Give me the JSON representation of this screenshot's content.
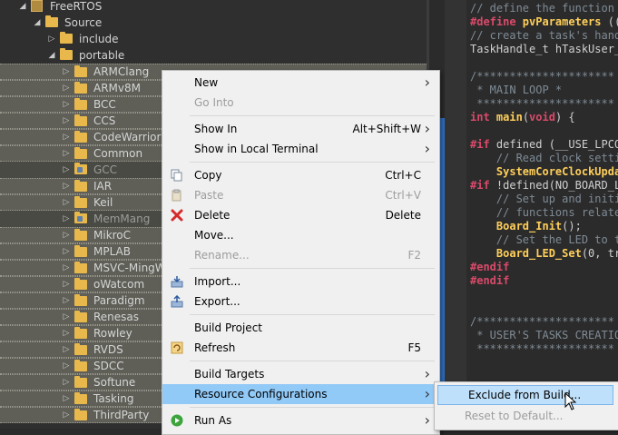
{
  "tree": {
    "rows": [
      {
        "label": "FreeRTOS",
        "indent": 1,
        "type": "project",
        "arrow": "open"
      },
      {
        "label": "Source",
        "indent": 2,
        "type": "folder",
        "arrow": "open"
      },
      {
        "label": "include",
        "indent": 3,
        "type": "folder",
        "arrow": "closed"
      },
      {
        "label": "portable",
        "indent": 3,
        "type": "folder",
        "arrow": "open"
      },
      {
        "label": "ARMClang",
        "indent": 4,
        "type": "folder",
        "arrow": "closed",
        "sel": true
      },
      {
        "label": "ARMv8M",
        "indent": 4,
        "type": "folder",
        "arrow": "closed",
        "sel": true
      },
      {
        "label": "BCC",
        "indent": 4,
        "type": "folder",
        "arrow": "closed",
        "sel": true
      },
      {
        "label": "CCS",
        "indent": 4,
        "type": "folder",
        "arrow": "closed",
        "sel": true
      },
      {
        "label": "CodeWarrior",
        "indent": 4,
        "type": "folder",
        "arrow": "closed",
        "sel": true
      },
      {
        "label": "Common",
        "indent": 4,
        "type": "folder",
        "arrow": "closed",
        "sel": true
      },
      {
        "label": "GCC",
        "indent": 4,
        "type": "folder",
        "arrow": "closed",
        "dim": true,
        "exc": true
      },
      {
        "label": "IAR",
        "indent": 4,
        "type": "folder",
        "arrow": "closed",
        "sel": true
      },
      {
        "label": "Keil",
        "indent": 4,
        "type": "folder",
        "arrow": "closed",
        "sel": true
      },
      {
        "label": "MemMang",
        "indent": 4,
        "type": "folder",
        "arrow": "closed",
        "dim": true,
        "exc": true
      },
      {
        "label": "MikroC",
        "indent": 4,
        "type": "folder",
        "arrow": "closed",
        "sel": true
      },
      {
        "label": "MPLAB",
        "indent": 4,
        "type": "folder",
        "arrow": "closed",
        "sel": true
      },
      {
        "label": "MSVC-MingW",
        "indent": 4,
        "type": "folder",
        "arrow": "closed",
        "sel": true
      },
      {
        "label": "oWatcom",
        "indent": 4,
        "type": "folder",
        "arrow": "closed",
        "sel": true
      },
      {
        "label": "Paradigm",
        "indent": 4,
        "type": "folder",
        "arrow": "closed",
        "sel": true
      },
      {
        "label": "Renesas",
        "indent": 4,
        "type": "folder",
        "arrow": "closed",
        "sel": true
      },
      {
        "label": "Rowley",
        "indent": 4,
        "type": "folder",
        "arrow": "closed",
        "sel": true
      },
      {
        "label": "RVDS",
        "indent": 4,
        "type": "folder",
        "arrow": "closed",
        "sel": true
      },
      {
        "label": "SDCC",
        "indent": 4,
        "type": "folder",
        "arrow": "closed",
        "sel": true
      },
      {
        "label": "Softune",
        "indent": 4,
        "type": "folder",
        "arrow": "closed",
        "sel": true
      },
      {
        "label": "Tasking",
        "indent": 4,
        "type": "folder",
        "arrow": "closed",
        "sel": true
      },
      {
        "label": "ThirdParty",
        "indent": 4,
        "type": "folder",
        "arrow": "closed",
        "sel": true
      }
    ]
  },
  "editor": {
    "lines": [
      [
        {
          "t": "// define the function ",
          "c": "cmt"
        }
      ],
      [
        {
          "t": "#define ",
          "c": "kw"
        },
        {
          "t": "pvParameters",
          "c": "fn"
        },
        {
          "t": " ((",
          "c": "str"
        }
      ],
      [
        {
          "t": "// create a task's hand",
          "c": "cmt"
        }
      ],
      [
        {
          "t": "TaskHandle_t hTaskUser_",
          "c": "str"
        }
      ],
      [
        {
          "t": "",
          "c": "str"
        }
      ],
      [
        {
          "t": "/*********************",
          "c": "cmt"
        }
      ],
      [
        {
          "t": " * MAIN LOOP *",
          "c": "cmt"
        }
      ],
      [
        {
          "t": " *********************",
          "c": "cmt"
        }
      ],
      [
        {
          "t": "int ",
          "c": "kw"
        },
        {
          "t": "main",
          "c": "fn"
        },
        {
          "t": "(",
          "c": "str"
        },
        {
          "t": "void",
          "c": "kw"
        },
        {
          "t": ") {",
          "c": "str"
        }
      ],
      [
        {
          "t": "",
          "c": "str"
        }
      ],
      [
        {
          "t": "#if ",
          "c": "kw"
        },
        {
          "t": "defined (__USE_LPCO",
          "c": "str"
        }
      ],
      [
        {
          "t": "    // Read clock setti",
          "c": "cmt"
        }
      ],
      [
        {
          "t": "    ",
          "c": "str"
        },
        {
          "t": "SystemCoreClockUpda",
          "c": "fn"
        }
      ],
      [
        {
          "t": "#if ",
          "c": "kw"
        },
        {
          "t": "!defined(NO_BOARD_L",
          "c": "str"
        }
      ],
      [
        {
          "t": "    // Set up and initi",
          "c": "cmt"
        }
      ],
      [
        {
          "t": "    // functions relate",
          "c": "cmt"
        }
      ],
      [
        {
          "t": "    ",
          "c": "str"
        },
        {
          "t": "Board_Init",
          "c": "fn"
        },
        {
          "t": "();",
          "c": "str"
        }
      ],
      [
        {
          "t": "    // Set the LED to t",
          "c": "cmt"
        }
      ],
      [
        {
          "t": "    ",
          "c": "str"
        },
        {
          "t": "Board_LED_Set",
          "c": "fn"
        },
        {
          "t": "(0, tr",
          "c": "str"
        }
      ],
      [
        {
          "t": "#endif",
          "c": "kw"
        }
      ],
      [
        {
          "t": "#endif",
          "c": "kw"
        }
      ],
      [
        {
          "t": "",
          "c": "str"
        }
      ],
      [
        {
          "t": "",
          "c": "str"
        }
      ],
      [
        {
          "t": "/*********************",
          "c": "cmt"
        }
      ],
      [
        {
          "t": " * USER'S TASKS CREATION",
          "c": "cmt"
        }
      ],
      [
        {
          "t": " *********************",
          "c": "cmt"
        }
      ]
    ]
  },
  "menu": {
    "items": [
      {
        "label": "New",
        "shortcut": "",
        "submenu": true
      },
      {
        "label": "Go Into",
        "disabled": true
      },
      {
        "sep": true
      },
      {
        "label": "Show In",
        "shortcut": "Alt+Shift+W",
        "submenu": true
      },
      {
        "label": "Show in Local Terminal",
        "submenu": true
      },
      {
        "sep": true
      },
      {
        "label": "Copy",
        "shortcut": "Ctrl+C",
        "icon": "copy-icon"
      },
      {
        "label": "Paste",
        "shortcut": "Ctrl+V",
        "icon": "paste-icon",
        "disabled": true
      },
      {
        "label": "Delete",
        "shortcut": "Delete",
        "icon": "delete-icon"
      },
      {
        "label": "Move..."
      },
      {
        "label": "Rename...",
        "shortcut": "F2",
        "disabled": true
      },
      {
        "sep": true
      },
      {
        "label": "Import...",
        "icon": "import-icon"
      },
      {
        "label": "Export...",
        "icon": "export-icon"
      },
      {
        "sep": true
      },
      {
        "label": "Build Project"
      },
      {
        "label": "Refresh",
        "shortcut": "F5",
        "icon": "refresh-icon"
      },
      {
        "sep": true
      },
      {
        "label": "Build Targets",
        "submenu": true
      },
      {
        "label": "Resource Configurations",
        "submenu": true,
        "highlighted": true
      },
      {
        "sep": true
      },
      {
        "label": "Run As",
        "submenu": true,
        "icon": "run-icon"
      }
    ]
  },
  "submenu": {
    "items": [
      {
        "label": "Exclude from Build...",
        "highlighted": true
      },
      {
        "label": "Reset to Default...",
        "disabled": true
      }
    ]
  },
  "colors": {
    "accent": "#91c9f7",
    "folder": "#e8b84d"
  }
}
